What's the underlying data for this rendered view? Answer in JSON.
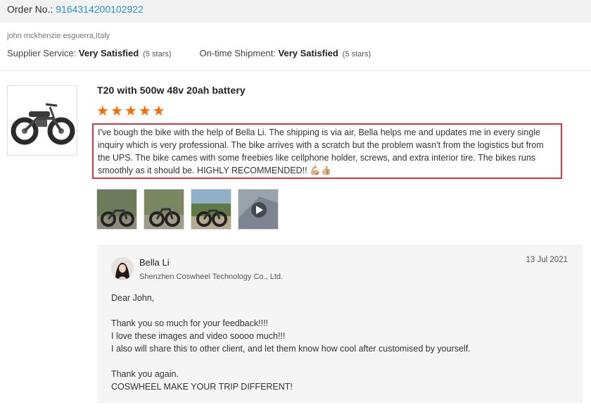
{
  "order": {
    "label": "Order No.: ",
    "number": "9164314200102922"
  },
  "buyer": "john mckhenzie esguerra,Italy",
  "ratings": [
    {
      "label": "Supplier Service: ",
      "value": "Very Satisfied",
      "note": "(5 stars)"
    },
    {
      "label": "On-time Shipment: ",
      "value": "Very Satisfied",
      "note": "(5 stars)"
    }
  ],
  "product": {
    "title": "T20 with 500w 48v 20ah battery",
    "thumb_icon": "ebike-image",
    "rating": 5
  },
  "review": {
    "text": "I've bough the bike with the help of Bella Li. The shipping is via air, Bella helps me and updates me in every single inquiry which is very professional. The bike arrives with a scratch but the problem wasn't from the logistics but from the UPS. The bike cames with some freebies like cellphone holder, screws, and extra interior tire. The bikes runs smoothly as it should be. HIGHLY RECOMMENDED!! 💪🏼👍🏼"
  },
  "photos": [
    "photo-1",
    "photo-2",
    "photo-3",
    "video-thumbnail"
  ],
  "reply": {
    "name": "Bella Li",
    "company": "Shenzhen Coswheel Technology Co., Ltd.",
    "date": "13 Jul 2021",
    "lines": [
      "Dear John,",
      "",
      "Thank you so much for your feedback!!!!",
      "I love these images and video soooo much!!!",
      "I also will share this to other client, and let them know how cool after customised by yourself.",
      "",
      "Thank you again.",
      "COSWHEEL MAKE YOUR TRIP DIFFERENT!"
    ]
  },
  "colors": {
    "star": "#ff6a00",
    "link": "#2a8fd6",
    "highlight_border": "#d9363e"
  }
}
